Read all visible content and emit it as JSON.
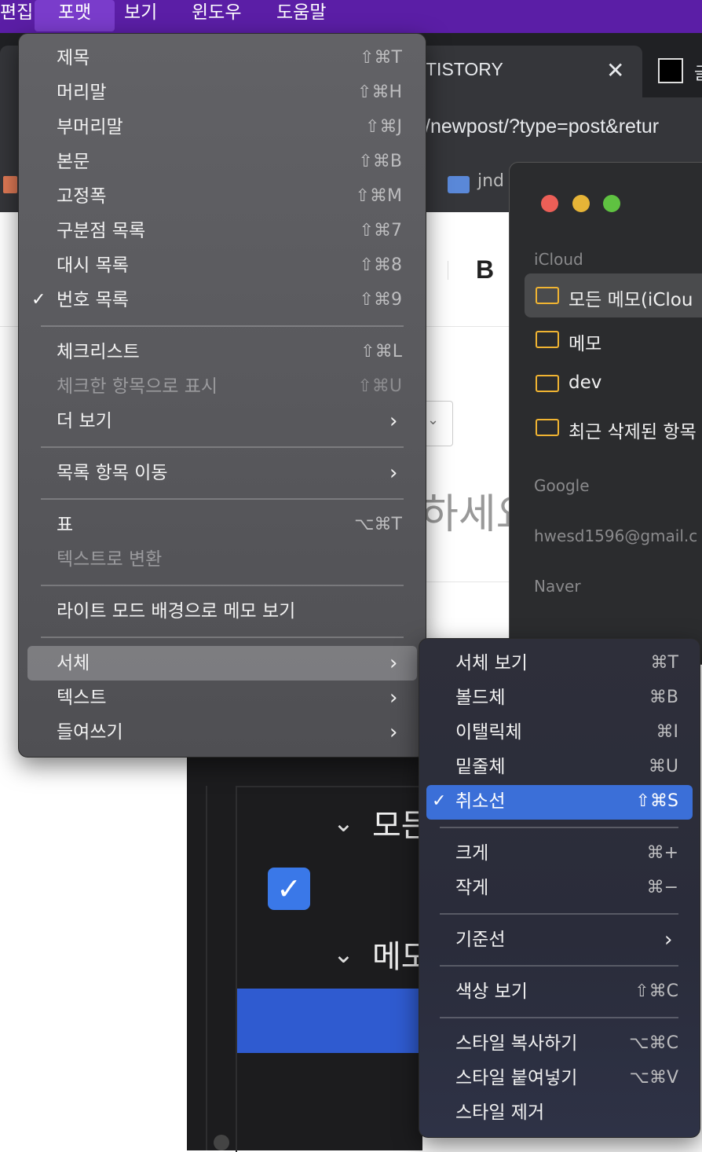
{
  "menubar": {
    "items": [
      "편집",
      "포맷",
      "보기",
      "윈도우",
      "도움말"
    ],
    "active": "포맷"
  },
  "browser": {
    "tab_title": "TISTORY",
    "tab_close": "✕",
    "tab2_text": "글",
    "url": "/newpost/?type=post&retur",
    "bookmark_text": "jnd",
    "bold_button": "B",
    "select_chevron": "⌄",
    "hint_text": "하세요"
  },
  "notes": {
    "sections": [
      "iCloud",
      "Google",
      "hwesd1596@gmail.c",
      "Naver"
    ],
    "folders": [
      "모든 메모(iClou",
      "메모",
      "dev",
      "최근 삭제된 항목"
    ],
    "traffic_colors": [
      "#ec5f57",
      "#e6b437",
      "#5fc241"
    ]
  },
  "dark_window": {
    "group1": "모든",
    "group2": "메모",
    "check": "✓",
    "chevron": "⌄"
  },
  "format_menu": {
    "items": [
      {
        "label": "제목",
        "shortcut": "⇧⌘T"
      },
      {
        "label": "머리말",
        "shortcut": "⇧⌘H"
      },
      {
        "label": "부머리말",
        "shortcut": "⇧⌘J"
      },
      {
        "label": "본문",
        "shortcut": "⇧⌘B"
      },
      {
        "label": "고정폭",
        "shortcut": "⇧⌘M"
      },
      {
        "label": "구분점 목록",
        "shortcut": "⇧⌘7"
      },
      {
        "label": "대시 목록",
        "shortcut": "⇧⌘8"
      },
      {
        "label": "번호 목록",
        "shortcut": "⇧⌘9",
        "checked": true
      },
      {
        "label": "체크리스트",
        "shortcut": "⇧⌘L"
      },
      {
        "label": "체크한 항목으로 표시",
        "shortcut": "⇧⌘U",
        "disabled": true
      },
      {
        "label": "더 보기",
        "submenu": true
      },
      {
        "label": "목록 항목 이동",
        "submenu": true
      },
      {
        "label": "표",
        "shortcut": "⌥⌘T"
      },
      {
        "label": "텍스트로 변환",
        "disabled": true
      },
      {
        "label": "라이트 모드 배경으로 메모 보기"
      },
      {
        "label": "서체",
        "submenu": true,
        "highlighted": true
      },
      {
        "label": "텍스트",
        "submenu": true
      },
      {
        "label": "들여쓰기",
        "submenu": true
      }
    ],
    "check_mark": "✓",
    "chevron": "›"
  },
  "font_menu": {
    "items": [
      {
        "label": "서체 보기",
        "shortcut": "⌘T"
      },
      {
        "label": "볼드체",
        "shortcut": "⌘B"
      },
      {
        "label": "이탤릭체",
        "shortcut": "⌘I"
      },
      {
        "label": "밑줄체",
        "shortcut": "⌘U"
      },
      {
        "label": "취소선",
        "shortcut": "⇧⌘S",
        "checked": true,
        "highlighted": true
      },
      {
        "label": "크게",
        "shortcut": "⌘+"
      },
      {
        "label": "작게",
        "shortcut": "⌘−"
      },
      {
        "label": "기준선",
        "submenu": true
      },
      {
        "label": "색상 보기",
        "shortcut": "⇧⌘C"
      },
      {
        "label": "스타일 복사하기",
        "shortcut": "⌥⌘C"
      },
      {
        "label": "스타일 붙여넣기",
        "shortcut": "⌥⌘V"
      },
      {
        "label": "스타일 제거"
      }
    ],
    "check_mark": "✓",
    "chevron": "›"
  }
}
